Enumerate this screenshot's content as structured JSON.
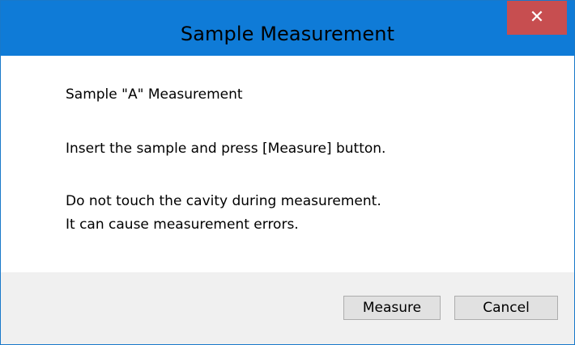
{
  "window": {
    "title": "Sample Measurement",
    "close_icon": "close-icon",
    "close_glyph": "✕",
    "colors": {
      "titlebar": "#0f7bd7",
      "close_button": "#c74e50",
      "footer": "#f0f0f0"
    }
  },
  "content": {
    "heading": "Sample \"A\" Measurement",
    "instruction": "Insert the sample and press [Measure] button.",
    "warning_line1": "Do not touch the cavity during measurement.",
    "warning_line2": "It can cause measurement errors."
  },
  "buttons": {
    "measure_label": "Measure",
    "cancel_label": "Cancel"
  }
}
